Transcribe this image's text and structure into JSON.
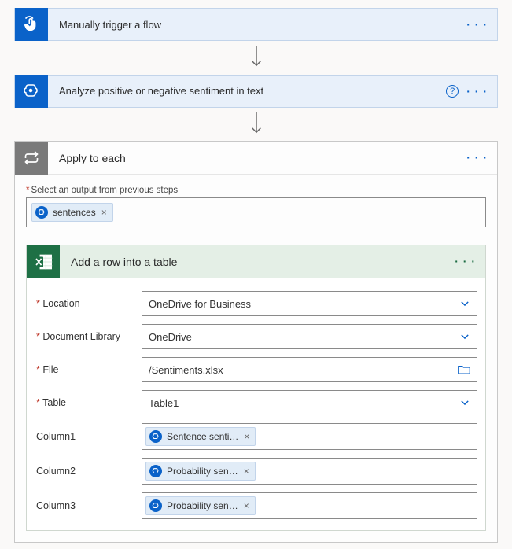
{
  "steps": {
    "manual": {
      "title": "Manually trigger a flow"
    },
    "analyze": {
      "title": "Analyze positive or negative sentiment in text"
    },
    "apply_each": {
      "title": "Apply to each",
      "output_label": "Select an output from previous steps",
      "output_token": "sentences"
    },
    "add_row": {
      "title": "Add a row into a table",
      "fields": {
        "location": {
          "label": "Location",
          "value": "OneDrive for Business"
        },
        "doclib": {
          "label": "Document Library",
          "value": "OneDrive"
        },
        "file": {
          "label": "File",
          "value": "/Sentiments.xlsx"
        },
        "table": {
          "label": "Table",
          "value": "Table1"
        },
        "col1": {
          "label": "Column1",
          "token": "Sentence senti…"
        },
        "col2": {
          "label": "Column2",
          "token": "Probability sen…"
        },
        "col3": {
          "label": "Column3",
          "token": "Probability sen…"
        }
      }
    }
  },
  "glyphs": {
    "ellipsis": "· · ·",
    "remove": "×",
    "help": "?"
  }
}
